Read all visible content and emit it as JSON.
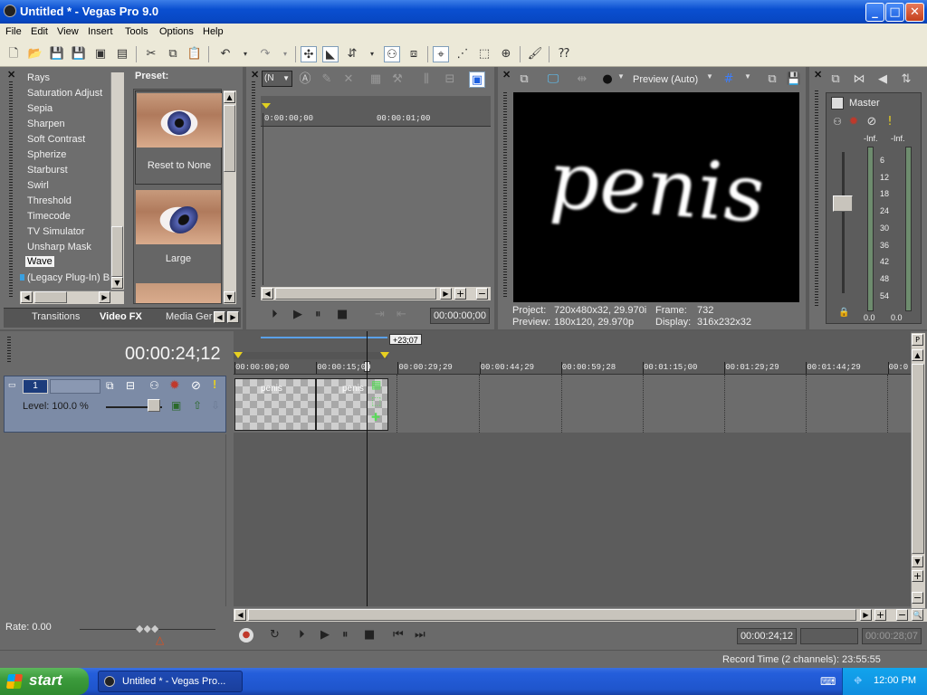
{
  "window": {
    "title": "Untitled * - Vegas Pro 9.0",
    "minimize": "_",
    "maximize": "□",
    "close": "✕"
  },
  "menu": [
    "File",
    "Edit",
    "View",
    "Insert",
    "Tools",
    "Options",
    "Help"
  ],
  "fx": {
    "items": [
      "Rays",
      "Saturation Adjust",
      "Sepia",
      "Sharpen",
      "Soft Contrast",
      "Spherize",
      "Starburst",
      "Swirl",
      "Threshold",
      "Timecode",
      "TV Simulator",
      "Unsharp Mask",
      "Wave",
      "(Legacy Plug-In) Br"
    ],
    "selected": "Wave",
    "preset_header": "Preset:",
    "presets": [
      "Reset to None",
      "Large"
    ],
    "tabs": [
      "Transitions",
      "Video FX",
      "Media Ger"
    ],
    "active_tab": "Video FX"
  },
  "trimmer": {
    "dropdown": "(N",
    "ruler_start": "0:00:00;00",
    "ruler_mark": "00:00:01;00",
    "timecode": "00:00:00;00"
  },
  "preview": {
    "mode": "Preview (Auto)",
    "text": "penis",
    "project_label": "Project:",
    "project_value": "720x480x32, 29.970i",
    "frame_label": "Frame:",
    "frame_value": "732",
    "preview_label": "Preview:",
    "preview_value": "180x120, 29.970p",
    "display_label": "Display:",
    "display_value": "316x232x32"
  },
  "mixer": {
    "master": "Master",
    "peak_left": "-Inf.",
    "peak_right": "-Inf.",
    "scale": [
      "6",
      "12",
      "18",
      "24",
      "30",
      "36",
      "42",
      "48",
      "54"
    ],
    "bottom_left": "0.0",
    "bottom_right": "0.0"
  },
  "timeline": {
    "cursor_time": "00:00:24;12",
    "loop_length": "+23;07",
    "ruler": [
      "00:00:00;00",
      "00:00:15;00",
      "00:00:29;29",
      "00:00:44;29",
      "00:00:59;28",
      "00:01:15;00",
      "00:01:29;29",
      "00:01:44;29",
      "00:0"
    ],
    "track_number": "1",
    "level": "Level: 100.0 %",
    "clips": [
      "penis",
      "penis"
    ],
    "rate": "Rate: 0.00",
    "transport_time": "00:00:24;12",
    "selection_length": "00:00:28;07",
    "record_time": "Record Time (2 channels): 23:55:55"
  },
  "taskbar": {
    "start": "start",
    "task": "Untitled * - Vegas Pro...",
    "clock": "12:00 PM"
  }
}
